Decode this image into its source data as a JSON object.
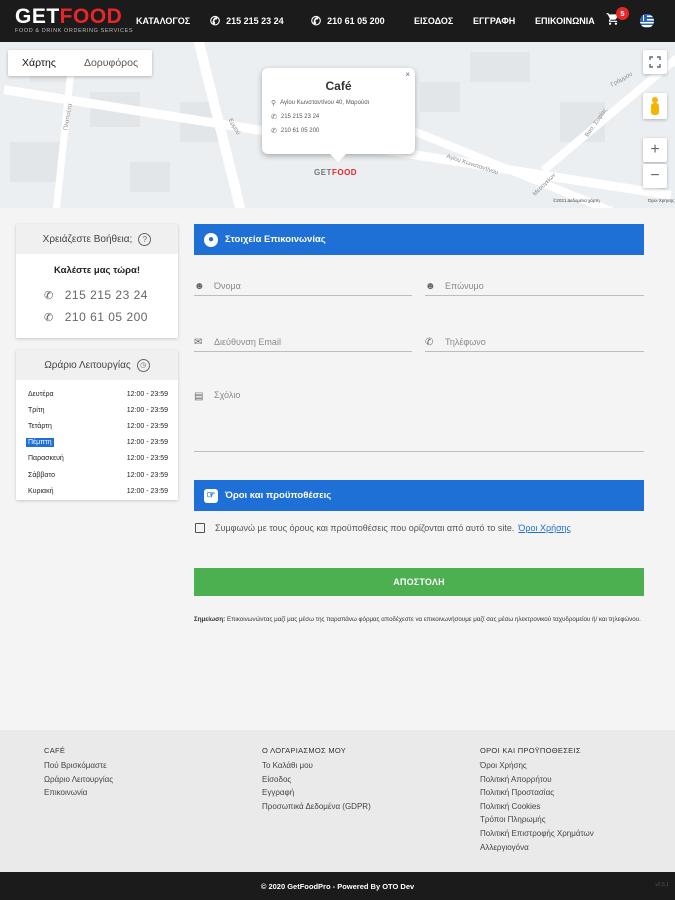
{
  "header": {
    "logo_get": "GET",
    "logo_food": "FOOD",
    "logo_tagline": "FOOD & DRINK ORDERING SERVICES",
    "nav_catalog": "ΚΑΤΑΛΟΓΟΣ",
    "phone_1": "215 215 23 24",
    "phone_2": "210 61 05 200",
    "nav_login": "ΕΙΣΟΔΟΣ",
    "nav_register": "ΕΓΓΡΑΦΗ",
    "nav_contact": "ΕΠΙΚΟΙΝΩΝΙΑ",
    "cart_count": "5",
    "cart_icon": "shopping-cart-icon",
    "language_flag": "greek-flag-icon"
  },
  "map": {
    "tab_map": "Χάρτης",
    "tab_satellite": "Δορυφόρος",
    "zoom_in": "+",
    "zoom_out": "−",
    "fullscreen_icon": "fullscreen-icon",
    "popup": {
      "title": "Café",
      "address": "Αγίου Κωνσταντίνου 40, Μαρούσι",
      "phone_1": "215 215 23 24",
      "phone_2": "210 61 05 200",
      "close": "×"
    },
    "marker_get": "GET",
    "marker_food": "FOOD",
    "street_1": "Γράμμου",
    "street_2": "Αγίου Κωνσταντίνου",
    "street_3": "Ερμού",
    "street_4": "Πλαπούτα",
    "street_5": "Βασ. Σοφίας",
    "street_6": "Μεσογείων",
    "attribution": "©2021 Δεδομένα χάρτη",
    "terms": "Όροι Χρήσης"
  },
  "help_card": {
    "title": "Χρειάζεστε Βοήθεια;",
    "subtitle": "Καλέστε μας τώρα!",
    "phone_1": "215 215 23 24",
    "phone_2": "210 61 05 200"
  },
  "hours_card": {
    "title": "Ωράριο Λειτουργίας",
    "rows": [
      {
        "day": "Δευτέρα",
        "hours": "12:00 - 23:59"
      },
      {
        "day": "Τρίτη",
        "hours": "12:00 - 23:59"
      },
      {
        "day": "Τετάρτη",
        "hours": "12:00 - 23:59"
      },
      {
        "day": "Πέμπτη",
        "hours": "12:00 - 23:59"
      },
      {
        "day": "Παρασκευή",
        "hours": "12:00 - 23:59"
      },
      {
        "day": "Σάββατο",
        "hours": "12:00 - 23:59"
      },
      {
        "day": "Κυριακή",
        "hours": "12:00 - 23:59"
      }
    ]
  },
  "form": {
    "section_contact": "Στοιχεία Επικοινωνίας",
    "first_name_placeholder": "Όνομα",
    "last_name_placeholder": "Επώνυμο",
    "email_placeholder": "Διεύθυνση Email",
    "phone_placeholder": "Τηλέφωνο",
    "comment_placeholder": "Σχόλιο",
    "section_terms": "Όροι και προϋποθέσεις",
    "terms_text": "Συμφωνώ με τους όρους και προϋποθέσεις που ορίζονται από αυτό το site.",
    "terms_link": "Όροι Χρήσης",
    "submit": "ΑΠΟΣΤΟΛΗ",
    "note_label": "Σημείωση:",
    "note_text": "Επικοινωνώντας μαζί μας μέσω της παραπάνω φόρμας αποδέχεστε να επικοινωνήσουμε μαζί σας μέσω ηλεκτρονικού ταχυδρομείου ή/ και τηλεφώνου."
  },
  "footer": {
    "col1": {
      "title": "CAFÉ",
      "links": [
        "Πού Βρισκόμαστε",
        "Ωράριο Λειτουργίας",
        "Επικοινωνία"
      ]
    },
    "col2": {
      "title": "Ο ΛΟΓΑΡΙΑΣΜΟΣ ΜΟΥ",
      "links": [
        "Το Καλάθι μου",
        "Είσοδος",
        "Εγγραφή",
        "Προσωπικά Δεδομένα (GDPR)"
      ]
    },
    "col3": {
      "title": "ΟΡΟΙ ΚΑΙ ΠΡΟΫΠΟΘΕΣΕΙΣ",
      "links": [
        "Όροι Χρήσης",
        "Πολιτική Απορρήτου",
        "Πολιτική Προστασίας",
        "Πολιτική Cookies",
        "Τρόποι Πληρωμής",
        "Πολιτική Επιστροφής Χρημάτων",
        "Αλλεργιογόνα"
      ]
    },
    "copyright": "© 2020 GetFoodPro - Powered By OTO Dev",
    "version": "v2.5.1"
  },
  "colors": {
    "brand_red": "#e8262a",
    "header_bg": "#1b1b1b",
    "section_blue": "#1e6fd6",
    "submit_green": "#4caf50"
  }
}
